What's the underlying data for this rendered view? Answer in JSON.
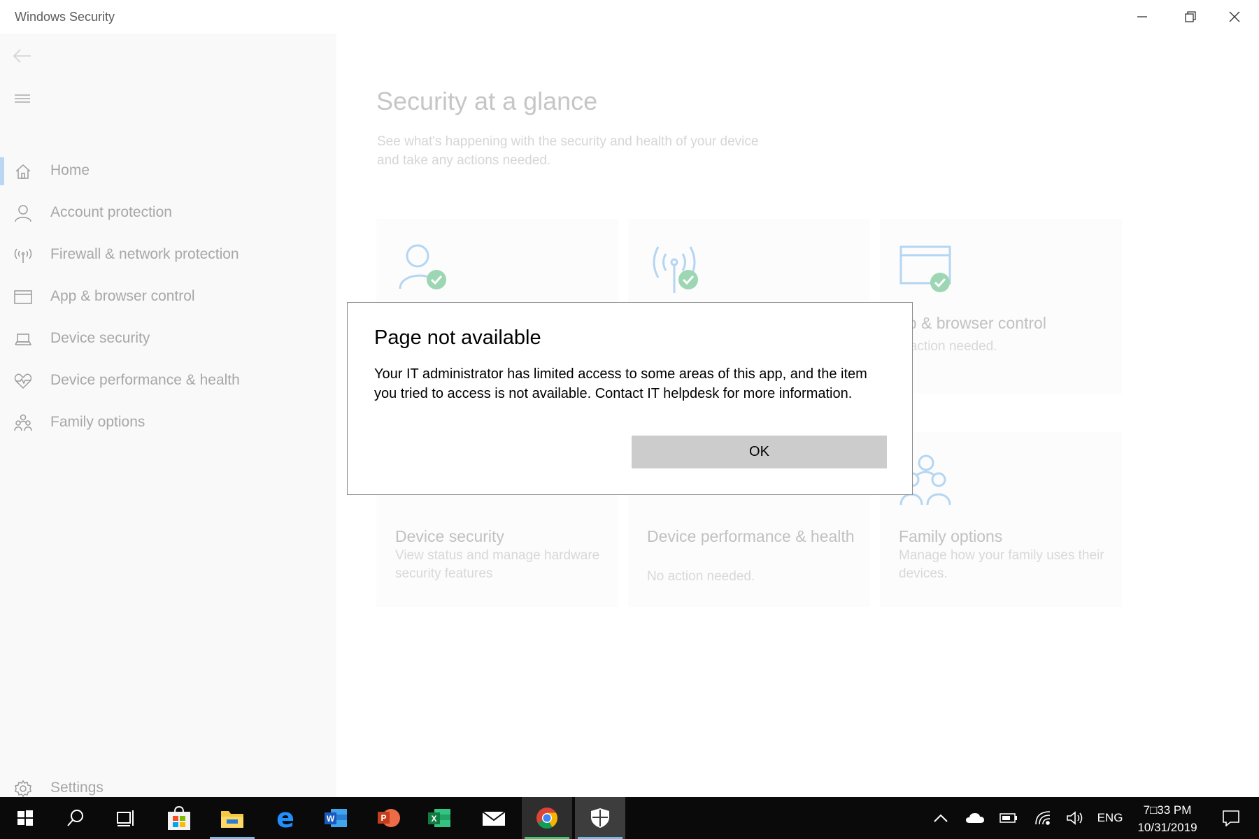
{
  "window": {
    "title": "Windows Security",
    "controls": {
      "minimize": "minimize-icon",
      "restore": "restore-icon",
      "close": "close-icon"
    }
  },
  "sidebar": {
    "back_icon": "back-arrow-icon",
    "menu_icon": "hamburger-icon",
    "items": [
      {
        "label": "Home",
        "icon": "home-icon",
        "active": true
      },
      {
        "label": "Account protection",
        "icon": "person-icon"
      },
      {
        "label": "Firewall & network protection",
        "icon": "antenna-icon"
      },
      {
        "label": "App & browser control",
        "icon": "browser-window-icon"
      },
      {
        "label": "Device security",
        "icon": "laptop-icon"
      },
      {
        "label": "Device performance & health",
        "icon": "heart-icon"
      },
      {
        "label": "Family options",
        "icon": "family-icon"
      }
    ],
    "settings": {
      "label": "Settings",
      "icon": "gear-icon"
    }
  },
  "main": {
    "title": "Security at a glance",
    "subtitle": "See what's happening with the security and health of your device and take any actions needed.",
    "tiles": [
      {
        "title": "",
        "desc": "",
        "icon": "person-check-icon"
      },
      {
        "title": "",
        "desc": "",
        "icon": "antenna-check-icon"
      },
      {
        "title": "pp & browser control",
        "desc": "o action needed.",
        "icon": "browser-check-icon"
      },
      {
        "title": "Device security",
        "desc": "View status and manage hardware security features",
        "icon": "laptop-icon"
      },
      {
        "title": "Device performance & health",
        "desc": "No action needed.",
        "icon": "heart-icon"
      },
      {
        "title": "Family options",
        "desc": "Manage how your family uses their devices.",
        "icon": "family-icon"
      }
    ]
  },
  "dialog": {
    "title": "Page not available",
    "message": "Your IT administrator has limited access to some areas of this app, and the item you tried to access is not available.  Contact IT helpdesk for more information.",
    "ok_label": "OK"
  },
  "taskbar": {
    "apps": [
      {
        "name": "start",
        "icon": "windows-logo-icon"
      },
      {
        "name": "search",
        "icon": "search-icon"
      },
      {
        "name": "task-view",
        "icon": "task-view-icon"
      },
      {
        "name": "store",
        "icon": "store-icon"
      },
      {
        "name": "file-explorer",
        "icon": "folder-icon"
      },
      {
        "name": "edge",
        "icon": "edge-icon"
      },
      {
        "name": "word",
        "icon": "word-icon"
      },
      {
        "name": "powerpoint",
        "icon": "powerpoint-icon"
      },
      {
        "name": "excel",
        "icon": "excel-icon"
      },
      {
        "name": "mail",
        "icon": "mail-icon"
      },
      {
        "name": "chrome",
        "icon": "chrome-icon"
      },
      {
        "name": "windows-security",
        "icon": "shield-icon"
      }
    ],
    "tray": {
      "language": "ENG",
      "time": "7□33 PM",
      "date": "10/31/2019"
    },
    "colors": {
      "accent_blue": "#76b9ed",
      "accent_green": "#3ec96c",
      "check_green": "#6cc28a"
    }
  }
}
